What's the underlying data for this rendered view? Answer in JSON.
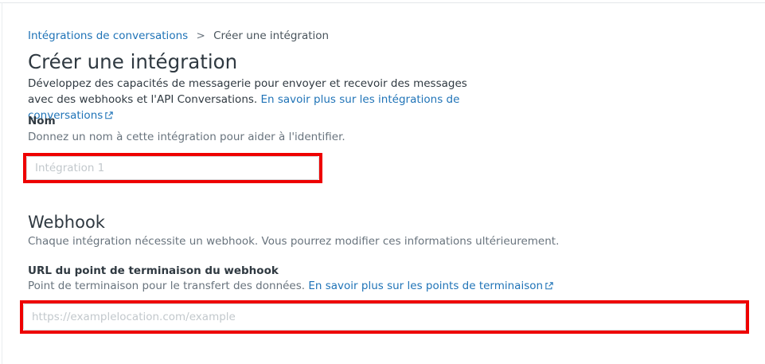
{
  "breadcrumb": {
    "parent": "Intégrations de conversations",
    "separator": ">",
    "current": "Créer une intégration"
  },
  "page": {
    "title": "Créer une intégration",
    "description": "Développez des capacités de messagerie pour envoyer et recevoir des messages avec des webhooks et l'API Conversations.",
    "learn_more_link": "En savoir plus sur les intégrations de conversations"
  },
  "name_field": {
    "label": "Nom",
    "hint": "Donnez un nom à cette intégration pour aider à l'identifier.",
    "placeholder": "Intégration 1",
    "value": ""
  },
  "webhook": {
    "title": "Webhook",
    "description": "Chaque intégration nécessite un webhook. Vous pourrez modifier ces informations ultérieurement.",
    "url_label": "URL du point de terminaison du webhook",
    "url_hint": "Point de terminaison pour le transfert des données.",
    "url_learn_more_link": "En savoir plus sur les points de terminaison",
    "url_placeholder": "https://examplelocation.com/example",
    "url_value": ""
  },
  "icons": {
    "breadcrumb_separator": "chevron-right-icon",
    "external_link": "external-link-icon"
  },
  "colors": {
    "link": "#1f73b7",
    "highlight_border": "#ee0000",
    "muted_text": "#68737d",
    "placeholder": "#c2c8cc"
  }
}
